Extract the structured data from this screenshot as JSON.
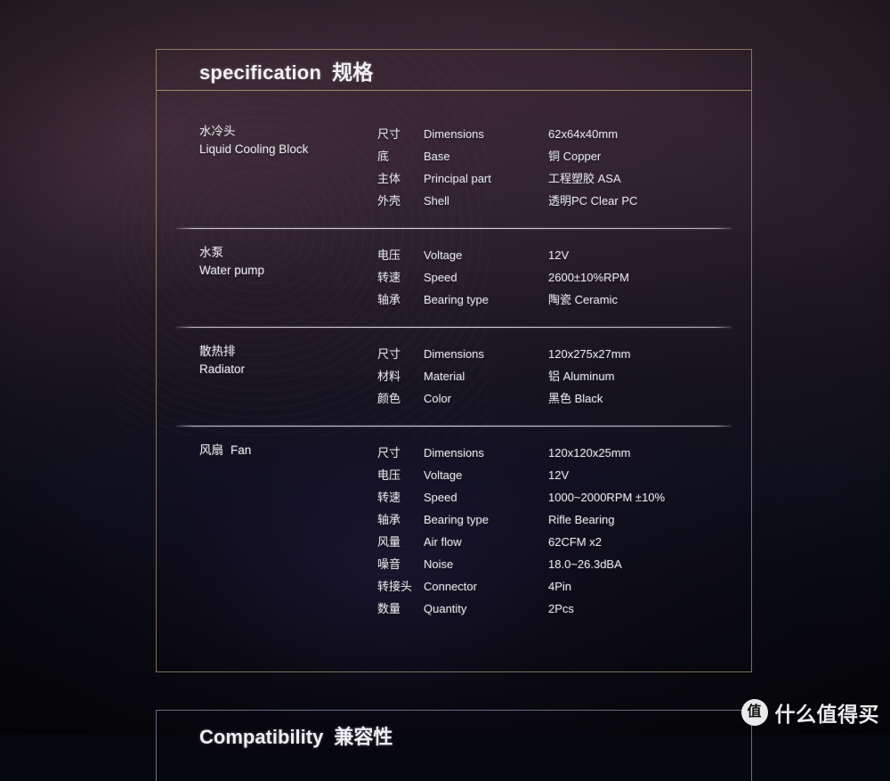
{
  "watermark": {
    "logo_glyph": "值",
    "text": "什么值得买"
  },
  "spec_panel": {
    "title_en": "specification",
    "title_cn": "规格",
    "sections": [
      {
        "label_cn": "水冷头",
        "label_en": "Liquid Cooling Block",
        "inline": false,
        "rows": [
          {
            "cn": "尺寸",
            "en": "Dimensions",
            "value": "62x64x40mm"
          },
          {
            "cn": "底",
            "en": "Base",
            "value": "铜 Copper"
          },
          {
            "cn": "主体",
            "en": "Principal part",
            "value": "工程塑胶 ASA"
          },
          {
            "cn": "外壳",
            "en": "Shell",
            "value": "透明PC  Clear PC"
          }
        ]
      },
      {
        "label_cn": "水泵",
        "label_en": "Water pump",
        "inline": false,
        "rows": [
          {
            "cn": "电压",
            "en": "Voltage",
            "value": "12V"
          },
          {
            "cn": "转速",
            "en": "Speed",
            "value": "2600±10%RPM"
          },
          {
            "cn": "轴承",
            "en": "Bearing type",
            "value": "陶瓷 Ceramic"
          }
        ]
      },
      {
        "label_cn": "散热排",
        "label_en": "Radiator",
        "inline": false,
        "rows": [
          {
            "cn": "尺寸",
            "en": "Dimensions",
            "value": "120x275x27mm"
          },
          {
            "cn": "材料",
            "en": "Material",
            "value": "铝 Aluminum"
          },
          {
            "cn": "颜色",
            "en": "Color",
            "value": "黑色 Black"
          }
        ]
      },
      {
        "label_cn": "风扇",
        "label_en": "Fan",
        "inline": true,
        "rows": [
          {
            "cn": "尺寸",
            "en": "Dimensions",
            "value": "120x120x25mm"
          },
          {
            "cn": "电压",
            "en": "Voltage",
            "value": "12V"
          },
          {
            "cn": "转速",
            "en": "Speed",
            "value": "1000~2000RPM ±10%"
          },
          {
            "cn": "轴承",
            "en": "Bearing type",
            "value": "Rifle Bearing"
          },
          {
            "cn": "风量",
            "en": "Air flow",
            "value": "62CFM x2"
          },
          {
            "cn": "噪音",
            "en": "Noise",
            "value": "18.0~26.3dBA"
          },
          {
            "cn": "转接头",
            "en": "Connector",
            "value": "4Pin"
          },
          {
            "cn": "数量",
            "en": "Quantity",
            "value": "2Pcs"
          }
        ]
      }
    ]
  },
  "compat_panel": {
    "title_en": "Compatibility",
    "title_cn": "兼容性"
  }
}
